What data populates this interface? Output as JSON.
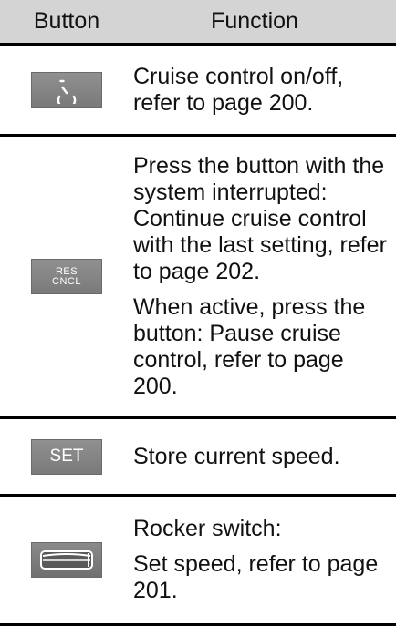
{
  "header": {
    "button_col": "Button",
    "function_col": "Function"
  },
  "rows": [
    {
      "icon": "cruise-control-icon",
      "paragraphs": [
        "Cruise control on/off, refer to page 200."
      ]
    },
    {
      "icon": "res-cncl-button-icon",
      "button_text_line1": "RES",
      "button_text_line2": "CNCL",
      "paragraphs": [
        "Press the button with the system interrupted: Continue cruise control with the last setting, refer to page 202.",
        "When active, press the button: Pause cruise control, refer to page 200."
      ]
    },
    {
      "icon": "set-button-icon",
      "button_text": "SET",
      "paragraphs": [
        "Store current speed."
      ]
    },
    {
      "icon": "rocker-switch-icon",
      "paragraphs": [
        "Rocker switch:",
        "Set speed, refer to page 201."
      ]
    }
  ]
}
